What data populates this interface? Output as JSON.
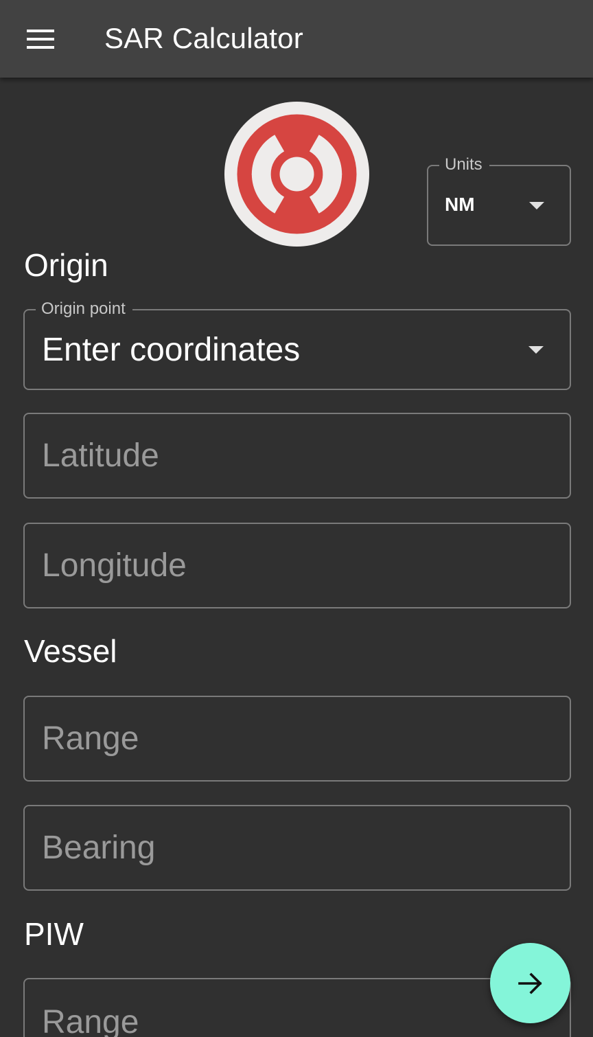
{
  "appbar": {
    "title": "SAR Calculator",
    "menu_icon": "menu-icon"
  },
  "logo": {
    "icon": "lifebuoy-icon",
    "colors": {
      "ring": "#d64541",
      "background": "#eeeceb"
    }
  },
  "units": {
    "label": "Units",
    "value": "NM"
  },
  "origin": {
    "heading": "Origin",
    "origin_point": {
      "label": "Origin point",
      "value": "Enter coordinates"
    },
    "latitude_placeholder": "Latitude",
    "longitude_placeholder": "Longitude"
  },
  "vessel": {
    "heading": "Vessel",
    "range_placeholder": "Range",
    "bearing_placeholder": "Bearing"
  },
  "piw": {
    "heading": "PIW",
    "range_placeholder": "Range"
  },
  "fab": {
    "icon": "arrow-right-icon",
    "color": "#84f5d9"
  },
  "theme": {
    "background": "#303030",
    "appbar": "#424242",
    "outline": "#7a7a7a"
  }
}
